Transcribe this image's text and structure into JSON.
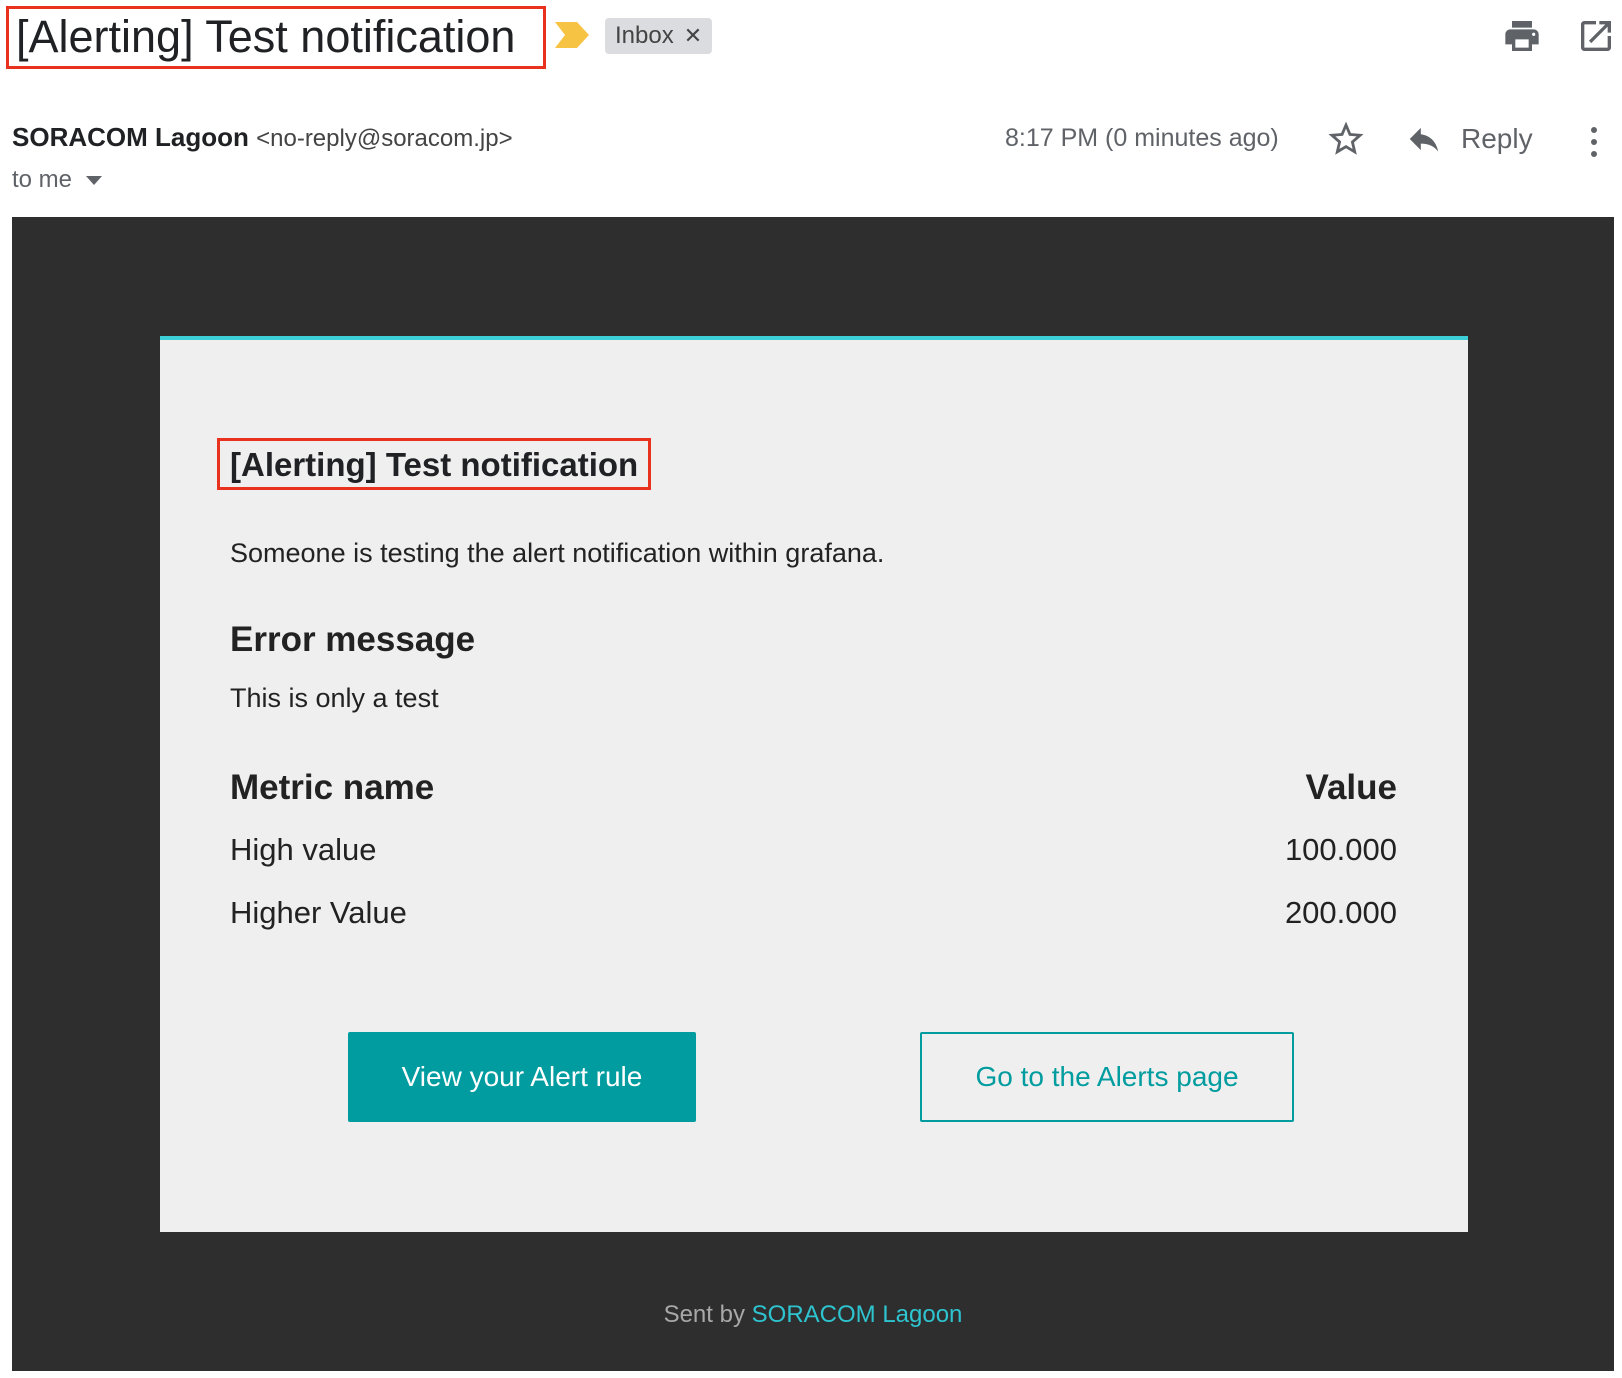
{
  "header": {
    "subject": "[Alerting] Test notification",
    "label_chip": "Inbox",
    "label_remove_glyph": "✕",
    "icons": [
      "importance-marker-icon",
      "print-icon",
      "open-in-new-window-icon"
    ]
  },
  "message": {
    "sender_name": "SORACOM Lagoon",
    "sender_email": "<no-reply@soracom.jp>",
    "recipient": "to me",
    "time": "8:17 PM (0 minutes ago)",
    "reply_label": "Reply",
    "icons": [
      "star-icon",
      "reply-icon",
      "more-vert-icon",
      "chevron-down-icon"
    ]
  },
  "email": {
    "title": "[Alerting] Test notification",
    "intro": "Someone is testing the alert notification within grafana.",
    "error_heading": "Error message",
    "error_message": "This is only a test",
    "metrics": {
      "header_name": "Metric name",
      "header_value": "Value",
      "rows": [
        {
          "name": "High value",
          "value": "100.000"
        },
        {
          "name": "Higher Value",
          "value": "200.000"
        }
      ]
    },
    "primary_button": "View your Alert rule",
    "secondary_button": "Go to the Alerts page",
    "footer_prefix": "Sent by",
    "footer_link": "SORACOM Lagoon"
  },
  "colors": {
    "highlight_box": "#e8321e",
    "accent_teal": "#009c9f",
    "card_top_border": "#3ccfd8",
    "frame_background": "#2e2e2e",
    "card_background": "#efefef",
    "importance_marker": "#f6c343"
  }
}
